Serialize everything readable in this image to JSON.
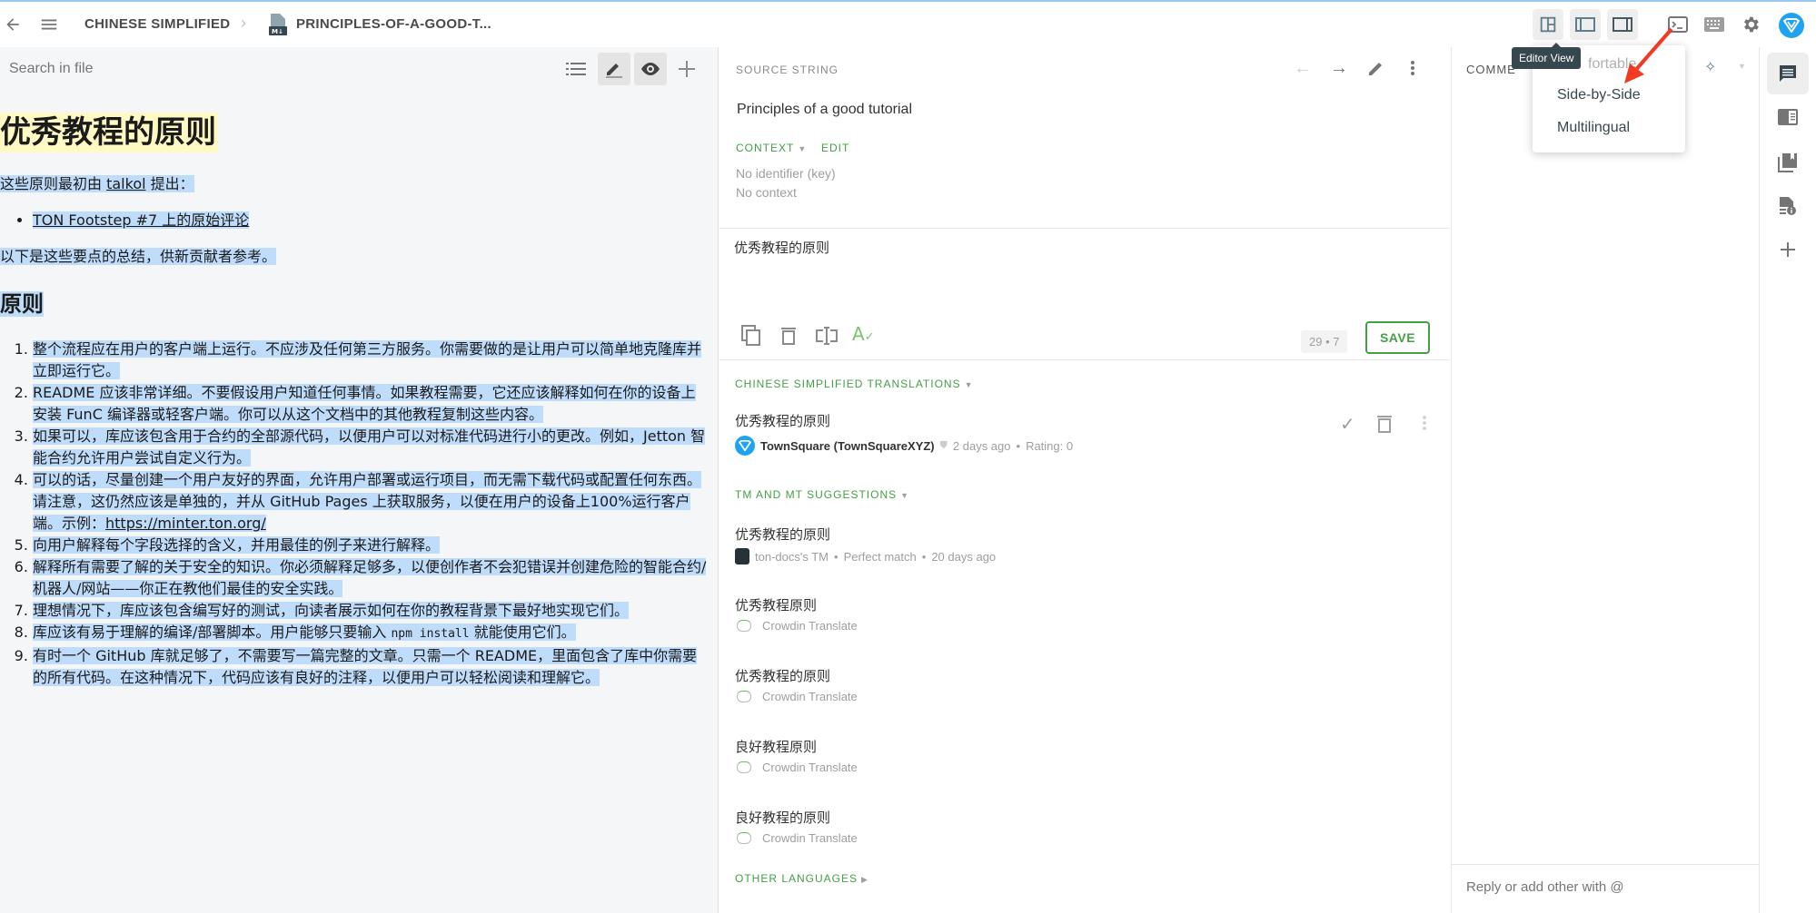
{
  "topbar": {
    "breadcrumb_language": "CHINESE SIMPLIFIED",
    "breadcrumb_file": "PRINCIPLES-OF-A-GOOD-T...",
    "file_icon": "markdown-file-icon",
    "tooltip": "Editor View"
  },
  "view_menu": {
    "partial_item": "fortable",
    "items": [
      "Side-by-Side",
      "Multilingual"
    ]
  },
  "left_panel": {
    "search_placeholder": "Search in file",
    "doc": {
      "title": "优秀教程的原则",
      "intro_pre": "这些原则最初由 ",
      "intro_link": "talkol",
      "intro_post": " 提出：",
      "bullet_link": "TON Footstep #7 上的原始评论",
      "summary": "以下是这些要点的总结，供新贡献者参考。",
      "section": "原则",
      "items": [
        "整个流程应在用户的客户端上运行。不应涉及任何第三方服务。你需要做的是让用户可以简单地克隆库并立即运行它。",
        "README 应该非常详细。不要假设用户知道任何事情。如果教程需要，它还应该解释如何在你的设备上安装 FunC 编译器或轻客户端。你可以从这个文档中的其他教程复制这些内容。",
        "如果可以，库应该包含用于合约的全部源代码，以便用户可以对标准代码进行小的更改。例如，Jetton 智能合约允许用户尝试自定义行为。",
        "可以的话，尽量创建一个用户友好的界面，允许用户部署或运行项目，而无需下载代码或配置任何东西。请注意，这仍然应该是单独的，并从 GitHub Pages 上获取服务，以便在用户的设备上100%运行客户端。示例：",
        "向用户解释每个字段选择的含义，并用最佳的例子来进行解释。",
        "解释所有需要了解的关于安全的知识。你必须解释足够多，以便创作者不会犯错误并创建危险的智能合约/机器人/网站——你正在教他们最佳的安全实践。",
        "理想情况下，库应该包含编写好的测试，向读者展示如何在你的教程背景下最好地实现它们。",
        "库应该有易于理解的编译/部署脚本。用户能够只要输入 ",
        "有时一个 GitHub 库就足够了，不需要写一篇完整的文章。只需一个 README，里面包含了库中你需要的所有代码。在这种情况下，代码应该有良好的注释，以便用户可以轻松阅读和理解它。"
      ],
      "item4_link": "https://minter.ton.org/",
      "item8_code": "npm install",
      "item8_post": " 就能使用它们。"
    }
  },
  "source": {
    "label": "SOURCE STRING",
    "text": "Principles of a good tutorial",
    "context_label": "CONTEXT",
    "edit_label": "EDIT",
    "identifier": "No identifier (key)",
    "context": "No context"
  },
  "editor": {
    "value": "优秀教程的原则",
    "counter": "29 • 7",
    "save_label": "SAVE"
  },
  "translations": {
    "label": "CHINESE SIMPLIFIED TRANSLATIONS",
    "items": [
      {
        "text": "优秀教程的原则",
        "author": "TownSquare (TownSquareXYZ)",
        "time": "2 days ago",
        "rating": "Rating: 0"
      }
    ]
  },
  "suggestions": {
    "label": "TM AND MT SUGGESTIONS",
    "items": [
      {
        "text": "优秀教程的原则",
        "source": "ton-docs's TM",
        "match": "Perfect match",
        "time": "20 days ago",
        "icon": "tm-icon"
      },
      {
        "text": "优秀教程原则",
        "source": "Crowdin Translate",
        "icon": "crowdin-translate-icon"
      },
      {
        "text": "优秀教程的原则",
        "source": "Crowdin Translate",
        "icon": "crowdin-translate-icon"
      },
      {
        "text": "良好教程原则",
        "source": "Crowdin Translate",
        "icon": "crowdin-translate-icon"
      },
      {
        "text": "良好教程的原则",
        "source": "Crowdin Translate",
        "icon": "crowdin-translate-icon"
      }
    ],
    "other_languages": "OTHER LANGUAGES"
  },
  "comments": {
    "label": "COMME",
    "reply_placeholder": "Reply or add other with @"
  },
  "colors": {
    "accent": "#43a047",
    "selection": "#bfdcfb",
    "title_highlight": "#fff9c4",
    "avatar": "#1fa3f0",
    "annotation_arrow": "#f23a23"
  }
}
